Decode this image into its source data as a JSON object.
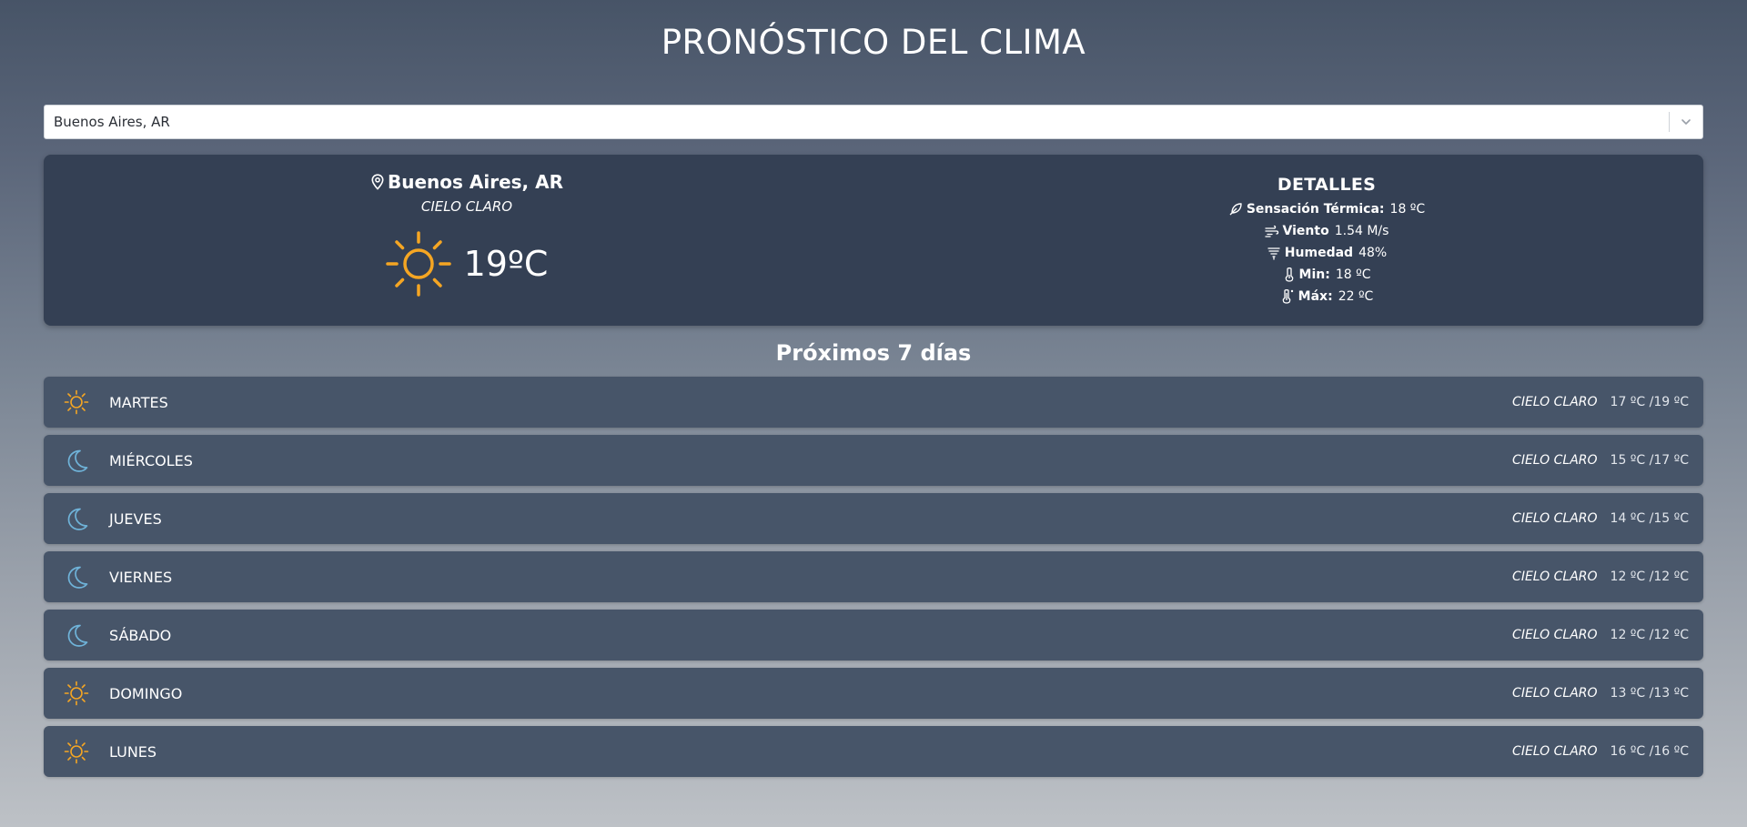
{
  "header": {
    "title": "PRONÓSTICO DEL CLIMA"
  },
  "search": {
    "selected_value": "Buenos Aires, AR"
  },
  "current": {
    "location": "Buenos Aires, AR",
    "description": "CIELO CLARO",
    "temperature": "19ºC",
    "icon": "sun-icon"
  },
  "details": {
    "title": "DETALLES",
    "feels_like": {
      "label": "Sensación Térmica:",
      "value": "18 ºC"
    },
    "wind": {
      "label": "Viento",
      "value": "1.54 M/s"
    },
    "humidity": {
      "label": "Humedad",
      "value": "48%"
    },
    "min": {
      "label": "Min:",
      "value": "18 ºC"
    },
    "max": {
      "label": "Máx:",
      "value": "22 ºC"
    }
  },
  "forecast": {
    "title": "Próximos 7 días",
    "days": [
      {
        "day": "MARTES",
        "description": "CIELO CLARO",
        "temps": "17 ºC /19 ºC",
        "icon": "sun-icon"
      },
      {
        "day": "MIÉRCOLES",
        "description": "CIELO CLARO",
        "temps": "15 ºC /17 ºC",
        "icon": "moon-icon"
      },
      {
        "day": "JUEVES",
        "description": "CIELO CLARO",
        "temps": "14 ºC /15 ºC",
        "icon": "moon-icon"
      },
      {
        "day": "VIERNES",
        "description": "CIELO CLARO",
        "temps": "12 ºC /12 ºC",
        "icon": "moon-icon"
      },
      {
        "day": "SÁBADO",
        "description": "CIELO CLARO",
        "temps": "12 ºC /12 ºC",
        "icon": "moon-icon"
      },
      {
        "day": "DOMINGO",
        "description": "CIELO CLARO",
        "temps": "13 ºC /13 ºC",
        "icon": "sun-icon"
      },
      {
        "day": "LUNES",
        "description": "CIELO CLARO",
        "temps": "16 ºC /16 ºC",
        "icon": "sun-icon"
      }
    ]
  },
  "colors": {
    "sun": "#f5a623",
    "moon": "#6fb3d9",
    "card": "#344054",
    "row": "#475569"
  }
}
